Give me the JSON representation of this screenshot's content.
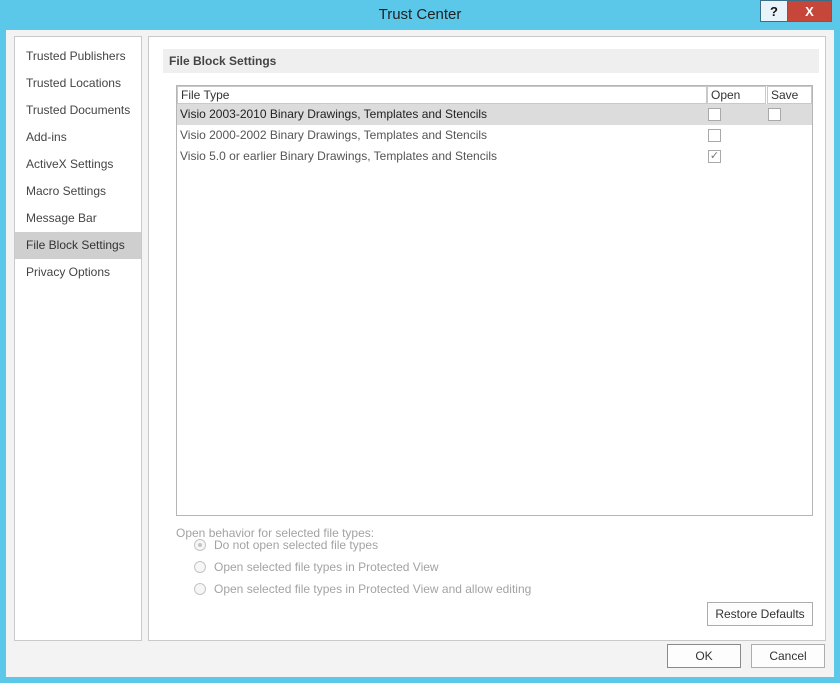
{
  "window": {
    "title": "Trust Center",
    "help_label": "?",
    "close_label": "X"
  },
  "sidebar": {
    "items": [
      {
        "label": "Trusted Publishers",
        "selected": false
      },
      {
        "label": "Trusted Locations",
        "selected": false
      },
      {
        "label": "Trusted Documents",
        "selected": false
      },
      {
        "label": "Add-ins",
        "selected": false
      },
      {
        "label": "ActiveX Settings",
        "selected": false
      },
      {
        "label": "Macro Settings",
        "selected": false
      },
      {
        "label": "Message Bar",
        "selected": false
      },
      {
        "label": "File Block Settings",
        "selected": true
      },
      {
        "label": "Privacy Options",
        "selected": false
      }
    ]
  },
  "main": {
    "section_title": "File Block Settings",
    "columns": {
      "file_type": "File Type",
      "open": "Open",
      "save": "Save"
    },
    "rows": [
      {
        "file_type": "Visio 2003-2010 Binary Drawings, Templates and Stencils",
        "open": false,
        "save": false,
        "has_save": true,
        "selected": true
      },
      {
        "file_type": "Visio 2000-2002 Binary Drawings, Templates and Stencils",
        "open": false,
        "save": null,
        "has_save": false,
        "selected": false
      },
      {
        "file_type": "Visio 5.0 or earlier Binary Drawings, Templates and Stencils",
        "open": true,
        "save": null,
        "has_save": false,
        "selected": false
      }
    ],
    "behavior": {
      "label": "Open behavior for selected file types:",
      "options": [
        {
          "label": "Do not open selected file types",
          "selected": true
        },
        {
          "label": "Open selected file types in Protected View",
          "selected": false
        },
        {
          "label": "Open selected file types in Protected View and allow editing",
          "selected": false
        }
      ]
    },
    "restore_defaults_label": "Restore Defaults"
  },
  "footer": {
    "ok_label": "OK",
    "cancel_label": "Cancel"
  },
  "colors": {
    "titlebar": "#5bc8ea",
    "close_button": "#c7463a",
    "selected_item": "#cfcfcf",
    "selected_row": "#dcdcdc"
  },
  "icons": {
    "checkmark": "check-icon"
  }
}
